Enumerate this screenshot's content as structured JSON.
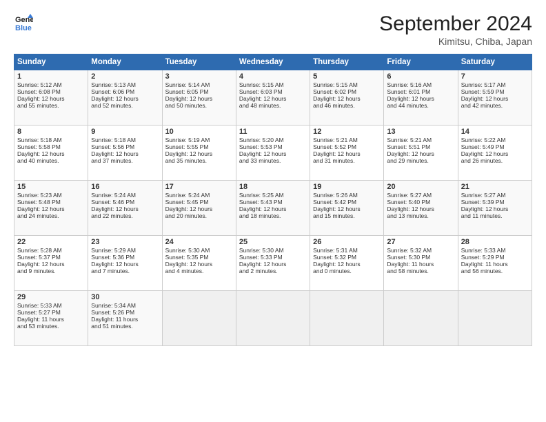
{
  "header": {
    "logo_line1": "General",
    "logo_line2": "Blue",
    "title": "September 2024",
    "subtitle": "Kimitsu, Chiba, Japan"
  },
  "columns": [
    "Sunday",
    "Monday",
    "Tuesday",
    "Wednesday",
    "Thursday",
    "Friday",
    "Saturday"
  ],
  "rows": [
    [
      {
        "day": "1",
        "lines": [
          "Sunrise: 5:12 AM",
          "Sunset: 6:08 PM",
          "Daylight: 12 hours",
          "and 55 minutes."
        ]
      },
      {
        "day": "2",
        "lines": [
          "Sunrise: 5:13 AM",
          "Sunset: 6:06 PM",
          "Daylight: 12 hours",
          "and 52 minutes."
        ]
      },
      {
        "day": "3",
        "lines": [
          "Sunrise: 5:14 AM",
          "Sunset: 6:05 PM",
          "Daylight: 12 hours",
          "and 50 minutes."
        ]
      },
      {
        "day": "4",
        "lines": [
          "Sunrise: 5:15 AM",
          "Sunset: 6:03 PM",
          "Daylight: 12 hours",
          "and 48 minutes."
        ]
      },
      {
        "day": "5",
        "lines": [
          "Sunrise: 5:15 AM",
          "Sunset: 6:02 PM",
          "Daylight: 12 hours",
          "and 46 minutes."
        ]
      },
      {
        "day": "6",
        "lines": [
          "Sunrise: 5:16 AM",
          "Sunset: 6:01 PM",
          "Daylight: 12 hours",
          "and 44 minutes."
        ]
      },
      {
        "day": "7",
        "lines": [
          "Sunrise: 5:17 AM",
          "Sunset: 5:59 PM",
          "Daylight: 12 hours",
          "and 42 minutes."
        ]
      }
    ],
    [
      {
        "day": "8",
        "lines": [
          "Sunrise: 5:18 AM",
          "Sunset: 5:58 PM",
          "Daylight: 12 hours",
          "and 40 minutes."
        ]
      },
      {
        "day": "9",
        "lines": [
          "Sunrise: 5:18 AM",
          "Sunset: 5:56 PM",
          "Daylight: 12 hours",
          "and 37 minutes."
        ]
      },
      {
        "day": "10",
        "lines": [
          "Sunrise: 5:19 AM",
          "Sunset: 5:55 PM",
          "Daylight: 12 hours",
          "and 35 minutes."
        ]
      },
      {
        "day": "11",
        "lines": [
          "Sunrise: 5:20 AM",
          "Sunset: 5:53 PM",
          "Daylight: 12 hours",
          "and 33 minutes."
        ]
      },
      {
        "day": "12",
        "lines": [
          "Sunrise: 5:21 AM",
          "Sunset: 5:52 PM",
          "Daylight: 12 hours",
          "and 31 minutes."
        ]
      },
      {
        "day": "13",
        "lines": [
          "Sunrise: 5:21 AM",
          "Sunset: 5:51 PM",
          "Daylight: 12 hours",
          "and 29 minutes."
        ]
      },
      {
        "day": "14",
        "lines": [
          "Sunrise: 5:22 AM",
          "Sunset: 5:49 PM",
          "Daylight: 12 hours",
          "and 26 minutes."
        ]
      }
    ],
    [
      {
        "day": "15",
        "lines": [
          "Sunrise: 5:23 AM",
          "Sunset: 5:48 PM",
          "Daylight: 12 hours",
          "and 24 minutes."
        ]
      },
      {
        "day": "16",
        "lines": [
          "Sunrise: 5:24 AM",
          "Sunset: 5:46 PM",
          "Daylight: 12 hours",
          "and 22 minutes."
        ]
      },
      {
        "day": "17",
        "lines": [
          "Sunrise: 5:24 AM",
          "Sunset: 5:45 PM",
          "Daylight: 12 hours",
          "and 20 minutes."
        ]
      },
      {
        "day": "18",
        "lines": [
          "Sunrise: 5:25 AM",
          "Sunset: 5:43 PM",
          "Daylight: 12 hours",
          "and 18 minutes."
        ]
      },
      {
        "day": "19",
        "lines": [
          "Sunrise: 5:26 AM",
          "Sunset: 5:42 PM",
          "Daylight: 12 hours",
          "and 15 minutes."
        ]
      },
      {
        "day": "20",
        "lines": [
          "Sunrise: 5:27 AM",
          "Sunset: 5:40 PM",
          "Daylight: 12 hours",
          "and 13 minutes."
        ]
      },
      {
        "day": "21",
        "lines": [
          "Sunrise: 5:27 AM",
          "Sunset: 5:39 PM",
          "Daylight: 12 hours",
          "and 11 minutes."
        ]
      }
    ],
    [
      {
        "day": "22",
        "lines": [
          "Sunrise: 5:28 AM",
          "Sunset: 5:37 PM",
          "Daylight: 12 hours",
          "and 9 minutes."
        ]
      },
      {
        "day": "23",
        "lines": [
          "Sunrise: 5:29 AM",
          "Sunset: 5:36 PM",
          "Daylight: 12 hours",
          "and 7 minutes."
        ]
      },
      {
        "day": "24",
        "lines": [
          "Sunrise: 5:30 AM",
          "Sunset: 5:35 PM",
          "Daylight: 12 hours",
          "and 4 minutes."
        ]
      },
      {
        "day": "25",
        "lines": [
          "Sunrise: 5:30 AM",
          "Sunset: 5:33 PM",
          "Daylight: 12 hours",
          "and 2 minutes."
        ]
      },
      {
        "day": "26",
        "lines": [
          "Sunrise: 5:31 AM",
          "Sunset: 5:32 PM",
          "Daylight: 12 hours",
          "and 0 minutes."
        ]
      },
      {
        "day": "27",
        "lines": [
          "Sunrise: 5:32 AM",
          "Sunset: 5:30 PM",
          "Daylight: 11 hours",
          "and 58 minutes."
        ]
      },
      {
        "day": "28",
        "lines": [
          "Sunrise: 5:33 AM",
          "Sunset: 5:29 PM",
          "Daylight: 11 hours",
          "and 56 minutes."
        ]
      }
    ],
    [
      {
        "day": "29",
        "lines": [
          "Sunrise: 5:33 AM",
          "Sunset: 5:27 PM",
          "Daylight: 11 hours",
          "and 53 minutes."
        ]
      },
      {
        "day": "30",
        "lines": [
          "Sunrise: 5:34 AM",
          "Sunset: 5:26 PM",
          "Daylight: 11 hours",
          "and 51 minutes."
        ]
      },
      {
        "day": "",
        "lines": []
      },
      {
        "day": "",
        "lines": []
      },
      {
        "day": "",
        "lines": []
      },
      {
        "day": "",
        "lines": []
      },
      {
        "day": "",
        "lines": []
      }
    ]
  ]
}
